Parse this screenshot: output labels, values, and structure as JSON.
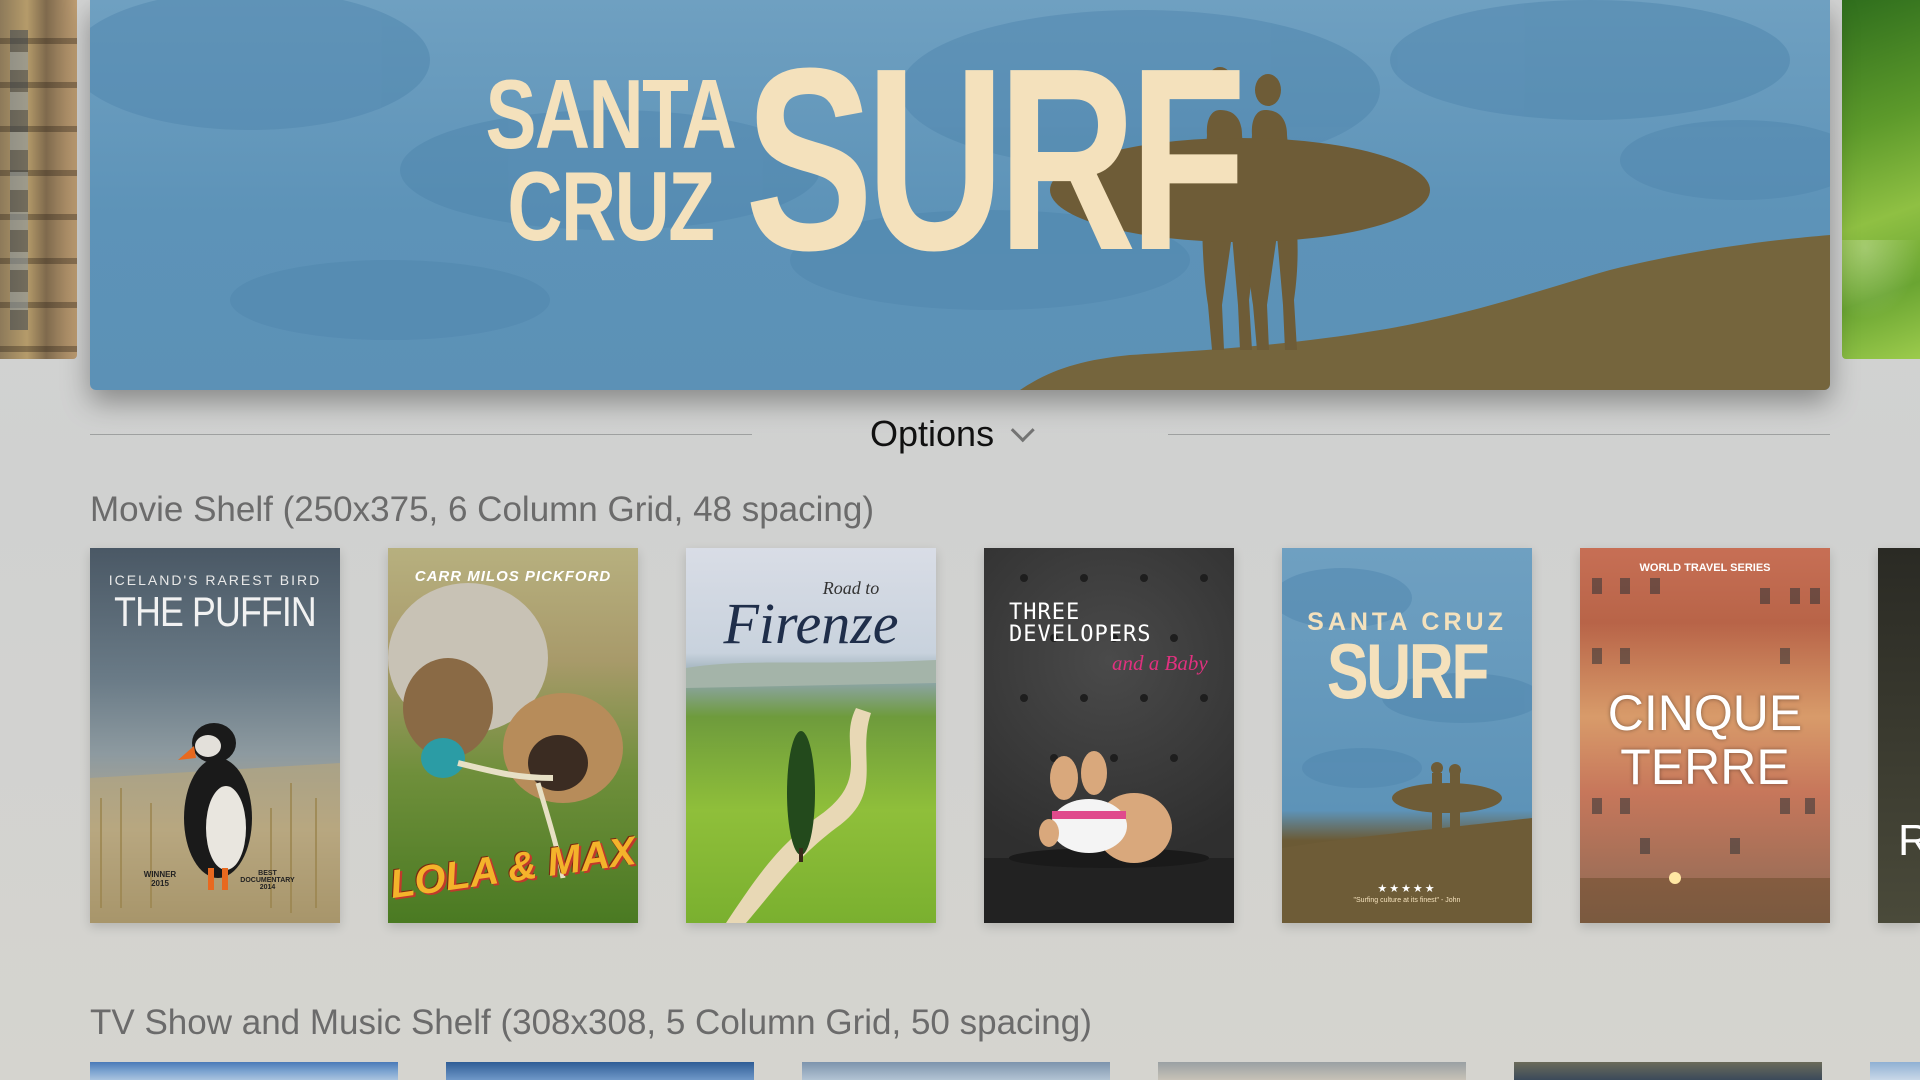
{
  "hero": {
    "title_small_line1": "SANTA",
    "title_small_line2": "CRUZ",
    "title_big": "SURF"
  },
  "options": {
    "label": "Options"
  },
  "movie_shelf": {
    "title": "Movie Shelf (250x375, 6 Column Grid, 48 spacing)",
    "posters": [
      {
        "tagline": "ICELAND'S RAREST BIRD",
        "title": "THE PUFFIN",
        "award1": "WINNER",
        "award1_year": "2015",
        "award2": "BEST DOCUMENTARY",
        "award2_year": "2014"
      },
      {
        "credits": "CARR  MILOS  PICKFORD",
        "title": "LOLA & MAX"
      },
      {
        "title_pre": "Road to",
        "title": "Firenze"
      },
      {
        "title_line1": "THREE",
        "title_line2": "DEVELOPERS",
        "subtitle": "and a Baby"
      },
      {
        "title_line1": "SANTA CRUZ",
        "title_big": "SURF",
        "rating": "★★★★★",
        "quote": "\"Surfing culture at its finest\" - John"
      },
      {
        "series": "WORLD TRAVEL SERIES",
        "title_line1": "CINQUE",
        "title_line2": "TERRE"
      },
      {
        "partial_letter": "R"
      }
    ]
  },
  "tv_shelf": {
    "title": "TV Show and Music Shelf (308x308, 5 Column Grid, 50 spacing)"
  }
}
